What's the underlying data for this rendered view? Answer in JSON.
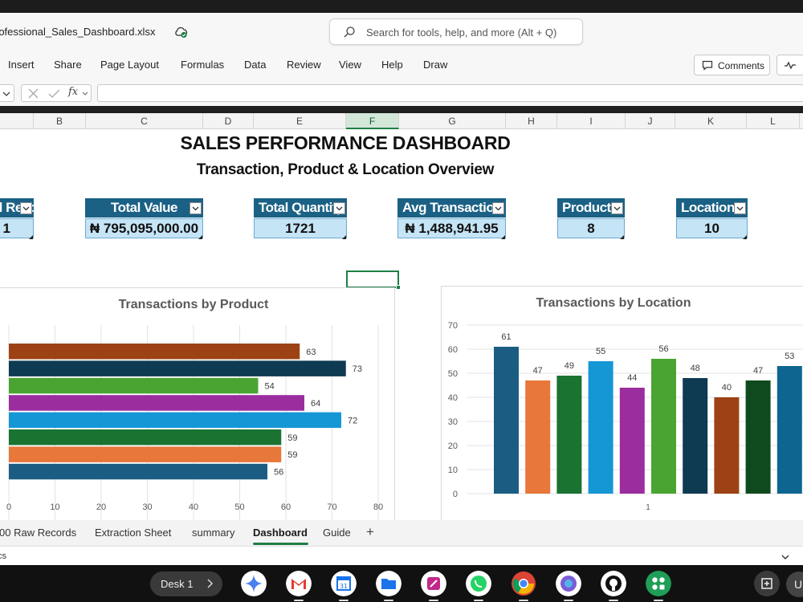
{
  "window": {
    "filename": "rofessional_Sales_Dashboard.xlsx",
    "search_placeholder": "Search for tools, help, and more (Alt + Q)"
  },
  "ribbon": {
    "tabs": [
      "Insert",
      "Share",
      "Page Layout",
      "Formulas",
      "Data",
      "Review",
      "View",
      "Help",
      "Draw"
    ],
    "comments_label": "Comments"
  },
  "formula_bar": {
    "fx_label": "fx"
  },
  "columns": [
    "B",
    "C",
    "D",
    "E",
    "F",
    "G",
    "H",
    "I",
    "J",
    "K",
    "L"
  ],
  "selected_column": "F",
  "dashboard": {
    "title": "SALES PERFORMANCE DASHBOARD",
    "subtitle": "Transaction, Product & Location Overview",
    "kpis": [
      {
        "label": "Total Records",
        "value": "1"
      },
      {
        "label": "Total Value",
        "value": "₦ 795,095,000.00"
      },
      {
        "label": "Total Quantity",
        "value": "1721"
      },
      {
        "label": "Avg Transaction",
        "value": "₦ 1,488,941.95"
      },
      {
        "label": "Products",
        "value": "8"
      },
      {
        "label": "Locations",
        "value": "10"
      }
    ]
  },
  "chart_data": [
    {
      "type": "bar",
      "orientation": "horizontal",
      "title": "Transactions by Product",
      "values": [
        63,
        73,
        54,
        64,
        72,
        59,
        59,
        56
      ],
      "colors": [
        "#9c4214",
        "#0e3a52",
        "#4aa432",
        "#9b2d9f",
        "#1597d6",
        "#1a7331",
        "#e8773a",
        "#1b5d82"
      ],
      "xlim": [
        0,
        80
      ],
      "xticks": [
        0,
        10,
        20,
        30,
        40,
        50,
        60,
        70,
        80
      ]
    },
    {
      "type": "bar",
      "orientation": "vertical",
      "title": "Transactions by Location",
      "categories": [
        "1"
      ],
      "values": [
        61,
        47,
        49,
        55,
        44,
        56,
        48,
        40,
        47,
        53
      ],
      "colors": [
        "#1b5d82",
        "#e8773a",
        "#1a7331",
        "#1597d6",
        "#9b2d9f",
        "#4aa432",
        "#0e3a52",
        "#9c4214",
        "#0f4a1e",
        "#0e6690"
      ],
      "ylim": [
        0,
        70
      ],
      "yticks": [
        0,
        10,
        20,
        30,
        40,
        50,
        60,
        70
      ]
    }
  ],
  "sheet_tabs": [
    "00 Raw Records",
    "Extraction Sheet",
    "summary",
    "Dashboard",
    "Guide"
  ],
  "active_sheet": "Dashboard",
  "status_text": "cs",
  "taskbar": {
    "desk_label": "Desk 1",
    "user_initial": "U"
  }
}
